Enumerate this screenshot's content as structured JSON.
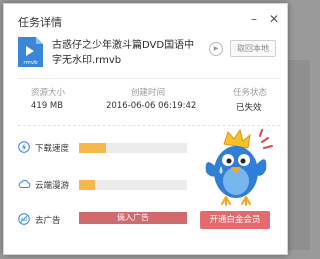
{
  "dialog": {
    "title": "任务详情",
    "minimize_icon": "minimize-icon",
    "close_icon": "close-icon"
  },
  "file": {
    "icon_label": "rmvb",
    "name": "古惑仔之少年激斗篇DVD国语中字无水印.rmvb",
    "play_icon": "play-icon",
    "cancel_label": "取回本地"
  },
  "info": {
    "size_label": "资源大小",
    "size_value": "419 MB",
    "created_label": "创建时间",
    "created_value": "2016-06-06 06:19:42",
    "status_label": "任务状态",
    "status_value": "已失效"
  },
  "rows": {
    "speed": {
      "label": "下载速度",
      "icon": "lightning-icon",
      "progress": 0.25
    },
    "cloud": {
      "label": "云端漫游",
      "icon": "cloud-icon",
      "progress": 0.15
    },
    "ad": {
      "label": "去广告",
      "icon": "ad-icon",
      "bar_text": "倘入广告"
    }
  },
  "vip_button": "开通白金会员",
  "colors": {
    "accent_blue": "#3a86d8",
    "progress_orange": "#f7b84b",
    "ad_red": "#d16a6e",
    "vip_red": "#e36b6f"
  }
}
